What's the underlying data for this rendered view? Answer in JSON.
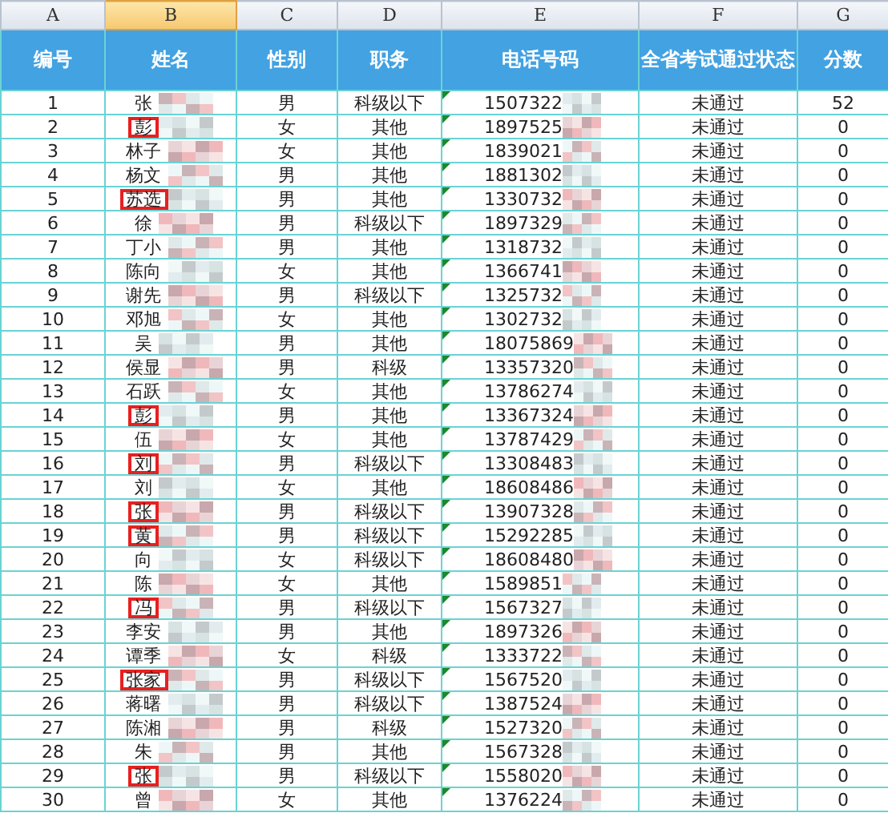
{
  "column_letters": [
    {
      "label": "A",
      "selected": false
    },
    {
      "label": "B",
      "selected": true
    },
    {
      "label": "C",
      "selected": false
    },
    {
      "label": "D",
      "selected": false
    },
    {
      "label": "E",
      "selected": false
    },
    {
      "label": "F",
      "selected": false
    },
    {
      "label": "G",
      "selected": false
    }
  ],
  "headers": [
    "编号",
    "姓名",
    "性别",
    "职务",
    "电话号码",
    "全省考试通过状态",
    "分数"
  ],
  "rows": [
    {
      "no": "1",
      "name": "张",
      "flagged": false,
      "gender": "男",
      "post": "科级以下",
      "phone": "1507322",
      "status": "未通过",
      "score": "52"
    },
    {
      "no": "2",
      "name": "彭",
      "flagged": true,
      "gender": "女",
      "post": "其他",
      "phone": "1897525",
      "status": "未通过",
      "score": "0"
    },
    {
      "no": "3",
      "name": "林子",
      "flagged": false,
      "gender": "女",
      "post": "其他",
      "phone": "1839021",
      "status": "未通过",
      "score": "0"
    },
    {
      "no": "4",
      "name": "杨文",
      "flagged": false,
      "gender": "男",
      "post": "其他",
      "phone": "1881302",
      "status": "未通过",
      "score": "0"
    },
    {
      "no": "5",
      "name": "苏选",
      "flagged": true,
      "gender": "男",
      "post": "其他",
      "phone": "1330732",
      "status": "未通过",
      "score": "0"
    },
    {
      "no": "6",
      "name": "徐",
      "flagged": false,
      "gender": "男",
      "post": "科级以下",
      "phone": "1897329",
      "status": "未通过",
      "score": "0"
    },
    {
      "no": "7",
      "name": "丁小",
      "flagged": false,
      "gender": "男",
      "post": "其他",
      "phone": "1318732",
      "status": "未通过",
      "score": "0"
    },
    {
      "no": "8",
      "name": "陈向",
      "flagged": false,
      "gender": "女",
      "post": "其他",
      "phone": "1366741",
      "status": "未通过",
      "score": "0"
    },
    {
      "no": "9",
      "name": "谢先",
      "flagged": false,
      "gender": "男",
      "post": "科级以下",
      "phone": "1325732",
      "status": "未通过",
      "score": "0"
    },
    {
      "no": "10",
      "name": "邓旭",
      "flagged": false,
      "gender": "女",
      "post": "其他",
      "phone": "1302732",
      "status": "未通过",
      "score": "0"
    },
    {
      "no": "11",
      "name": "吴",
      "flagged": false,
      "gender": "男",
      "post": "其他",
      "phone": "18075869",
      "status": "未通过",
      "score": "0"
    },
    {
      "no": "12",
      "name": "侯显",
      "flagged": false,
      "gender": "男",
      "post": "科级",
      "phone": "13357320",
      "status": "未通过",
      "score": "0"
    },
    {
      "no": "13",
      "name": "石跃",
      "flagged": false,
      "gender": "女",
      "post": "其他",
      "phone": "13786274",
      "status": "未通过",
      "score": "0"
    },
    {
      "no": "14",
      "name": "彭",
      "flagged": true,
      "gender": "男",
      "post": "其他",
      "phone": "13367324",
      "status": "未通过",
      "score": "0"
    },
    {
      "no": "15",
      "name": "伍",
      "flagged": false,
      "gender": "女",
      "post": "其他",
      "phone": "13787429",
      "status": "未通过",
      "score": "0"
    },
    {
      "no": "16",
      "name": "刘",
      "flagged": true,
      "gender": "男",
      "post": "科级以下",
      "phone": "13308483",
      "status": "未通过",
      "score": "0"
    },
    {
      "no": "17",
      "name": "刘",
      "flagged": false,
      "gender": "女",
      "post": "其他",
      "phone": "18608486",
      "status": "未通过",
      "score": "0"
    },
    {
      "no": "18",
      "name": "张",
      "flagged": true,
      "gender": "男",
      "post": "科级以下",
      "phone": "13907328",
      "status": "未通过",
      "score": "0"
    },
    {
      "no": "19",
      "name": "黄",
      "flagged": true,
      "gender": "男",
      "post": "科级以下",
      "phone": "15292285",
      "status": "未通过",
      "score": "0"
    },
    {
      "no": "20",
      "name": "向",
      "flagged": false,
      "gender": "女",
      "post": "科级以下",
      "phone": "18608480",
      "status": "未通过",
      "score": "0"
    },
    {
      "no": "21",
      "name": "陈",
      "flagged": false,
      "gender": "女",
      "post": "其他",
      "phone": "1589851",
      "status": "未通过",
      "score": "0"
    },
    {
      "no": "22",
      "name": "冯",
      "flagged": true,
      "gender": "男",
      "post": "科级以下",
      "phone": "1567327",
      "status": "未通过",
      "score": "0"
    },
    {
      "no": "23",
      "name": "李安",
      "flagged": false,
      "gender": "男",
      "post": "其他",
      "phone": "1897326",
      "status": "未通过",
      "score": "0"
    },
    {
      "no": "24",
      "name": "谭季",
      "flagged": false,
      "gender": "女",
      "post": "科级",
      "phone": "1333722",
      "status": "未通过",
      "score": "0"
    },
    {
      "no": "25",
      "name": "张家",
      "flagged": true,
      "gender": "男",
      "post": "科级以下",
      "phone": "1567520",
      "status": "未通过",
      "score": "0"
    },
    {
      "no": "26",
      "name": "蒋曙",
      "flagged": false,
      "gender": "男",
      "post": "科级以下",
      "phone": "1387524",
      "status": "未通过",
      "score": "0"
    },
    {
      "no": "27",
      "name": "陈湘",
      "flagged": false,
      "gender": "男",
      "post": "科级",
      "phone": "1527320",
      "status": "未通过",
      "score": "0"
    },
    {
      "no": "28",
      "name": "朱",
      "flagged": false,
      "gender": "男",
      "post": "其他",
      "phone": "1567328",
      "status": "未通过",
      "score": "0"
    },
    {
      "no": "29",
      "name": "张",
      "flagged": true,
      "gender": "男",
      "post": "科级以下",
      "phone": "1558020",
      "status": "未通过",
      "score": "0"
    },
    {
      "no": "30",
      "name": "曾",
      "flagged": false,
      "gender": "女",
      "post": "其他",
      "phone": "1376224",
      "status": "未通过",
      "score": "0"
    }
  ]
}
